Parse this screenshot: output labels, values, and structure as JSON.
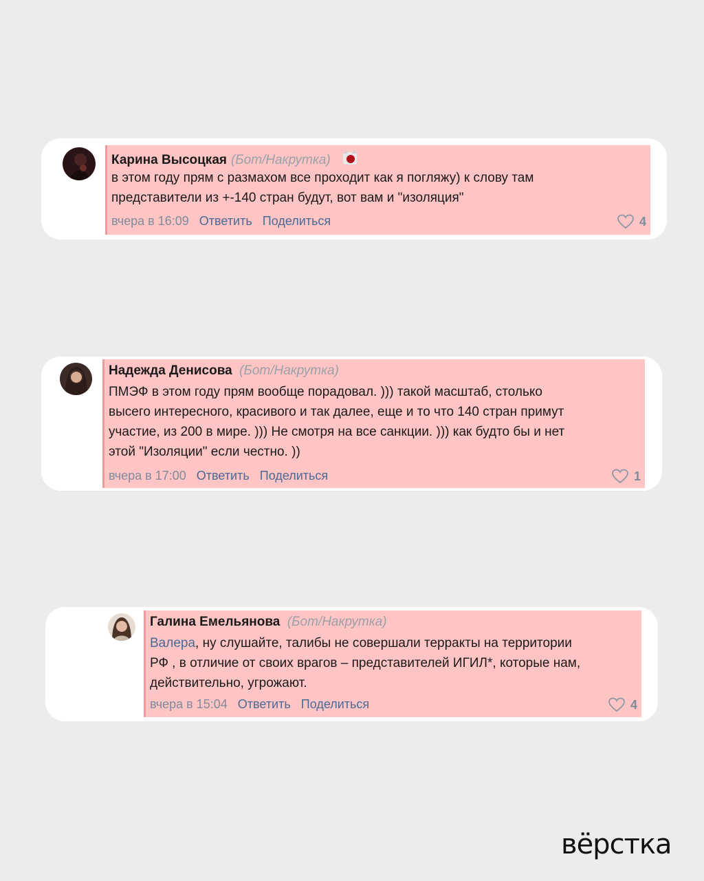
{
  "comments": [
    {
      "author": "Карина Высоцкая",
      "tag": "(Бот/Накрутка)",
      "text_lines": [
        "в этом году прям с размахом все проходит как я погляжу) к слову там",
        "представители из +-140 стран будут, вот вам и \"изоляция\""
      ],
      "time": "вчера в 16:09",
      "reply_label": "Ответить",
      "share_label": "Поделиться",
      "likes": "4"
    },
    {
      "author": "Надежда Денисова",
      "tag": "(Бот/Накрутка)",
      "text_lines": [
        "ПМЭФ в этом году прям вообще порадовал. ))) такой масштаб, столько",
        "высего интересного, красивого и так далее, еще и то что 140 стран примут",
        "участие, из 200 в мире. ))) Не смотря на все санкции. ))) как будто бы и нет",
        "этой \"Изоляции\" если честно. ))"
      ],
      "time": "вчера в 17:00",
      "reply_label": "Ответить",
      "share_label": "Поделиться",
      "likes": "1"
    },
    {
      "author": "Галина Емельянова",
      "tag": "(Бот/Накрутка)",
      "mention": "Валера",
      "text_lines": [
        ", ну слушайте, талибы не совершали терракты на территории",
        "РФ , в отличие от своих врагов – представителей ИГИЛ*, которые нам,",
        "действительно, угрожают."
      ],
      "time": "вчера в 15:04",
      "reply_label": "Ответить",
      "share_label": "Поделиться",
      "likes": "4"
    }
  ],
  "logo": "вёрстка",
  "colors": {
    "background": "#ececec",
    "highlight": "#ffc4c4",
    "link": "#4a6a95"
  }
}
